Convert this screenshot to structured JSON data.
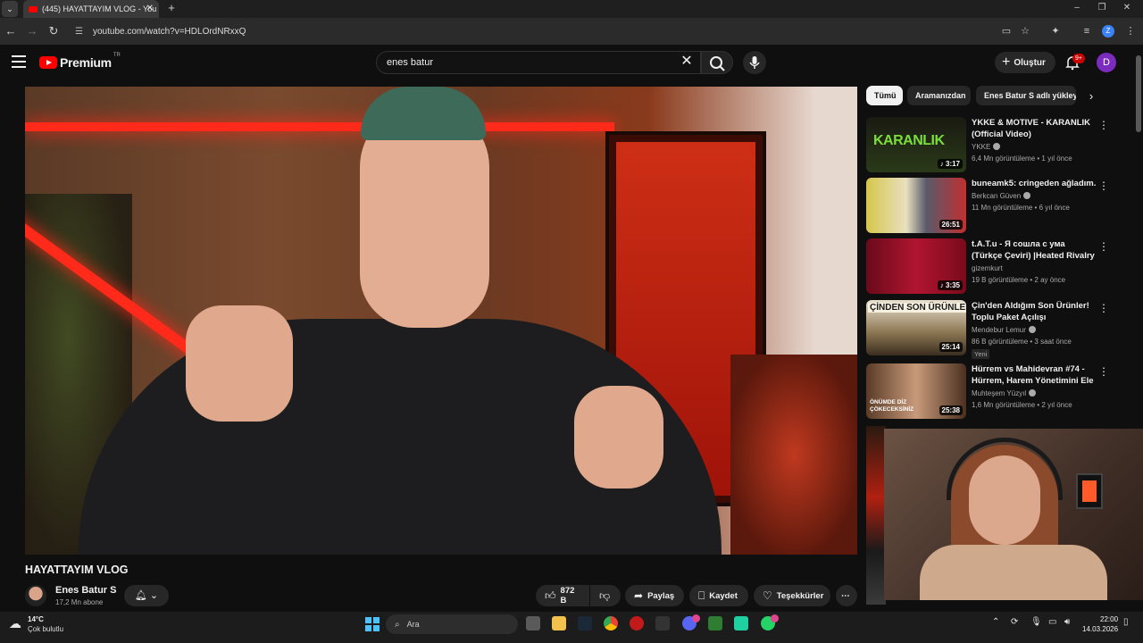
{
  "browser": {
    "tab_title": "(445) HAYATTAYIM VLOG - You",
    "url": "youtube.com/watch?v=HDLOrdNRxxQ",
    "profile_initial": "Z"
  },
  "masthead": {
    "logo_text": "Premium",
    "region": "TR",
    "search_value": "enes batur",
    "create_label": "Oluştur",
    "notifications_badge": "9+",
    "avatar_initial": "D"
  },
  "video": {
    "title": "HAYATTAYIM VLOG",
    "channel_name": "Enes Batur S",
    "subscribers": "17,2 Mn abone",
    "like_count": "872 B",
    "share_label": "Paylaş",
    "save_label": "Kaydet",
    "thanks_label": "Teşekkürler"
  },
  "chips": [
    "Tümü",
    "Aramanızdan",
    "Enes Batur S adlı yükleyiciden"
  ],
  "recommendations": [
    {
      "title": "YKKE & MOTIVE - KARANLIK (Official Video)",
      "channel": "YKKE",
      "meta": "6,4 Mn görüntüleme • 1 yıl önce",
      "duration": "♪ 3:17",
      "thumb_text": "KARANLIK",
      "thumb_color": "#1d2a14"
    },
    {
      "title": "buneamk5: cringeden ağladım.",
      "channel": "Berkcan Güven",
      "meta": "11 Mn görüntüleme • 6 yıl önce",
      "duration": "26:51",
      "thumb_color": "#5b5a6b"
    },
    {
      "title": "t.A.T.u - Я сошла с ума (Türkçe Çeviri) |Heated Rivalry / Ya ...",
      "channel": "gizemkurt",
      "meta": "19 B görüntüleme • 2 ay önce",
      "duration": "♪ 3:35",
      "thumb_color": "#8c0f22"
    },
    {
      "title": "Çin'den Aldığım Son Ürünler! Toplu Paket Açılışı",
      "channel": "Mendebur Lemur",
      "meta": "86 B görüntüleme • 3 saat önce",
      "badge": "Yeni",
      "duration": "25:14",
      "thumb_text": "ÇİNDEN SON ÜRÜNLER",
      "thumb_color": "#6a5a3a"
    },
    {
      "title": "Hürrem vs Mahidevran #74 - Hürrem, Harem Yönetimini Ele ...",
      "channel": "Muhteşem Yüzyıl",
      "meta": "1,6 Mn görüntüleme • 2 yıl önce",
      "duration": "25:38",
      "thumb_text": "ÖNÜMDE DİZ ÇÖKECEKSİNİZ",
      "thumb_color": "#7a5238"
    }
  ],
  "taskbar": {
    "temperature": "14°C",
    "weather": "Çok bulutlu",
    "search_placeholder": "Ara",
    "time": "22:00",
    "date": "14.03.2026"
  },
  "colors": {
    "background": "#0f0f0f",
    "youtube_red": "#ff0000",
    "chip_bg": "#272727",
    "text_secondary": "#aaaaaa"
  }
}
